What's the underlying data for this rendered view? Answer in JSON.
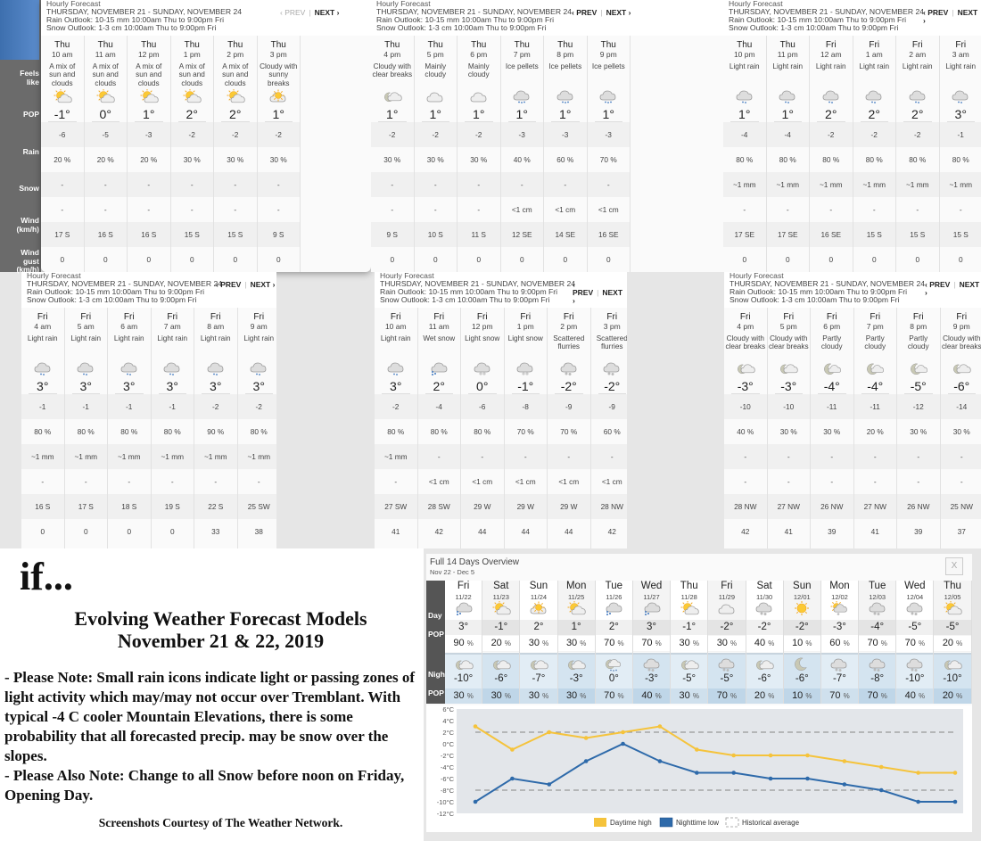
{
  "hourly_header": {
    "title": "Hourly Forecast",
    "range": "THURSDAY, NOVEMBER 21 - SUNDAY, NOVEMBER 24",
    "rain_outlook": "Rain Outlook: 10-15 mm 10:00am Thu to 9:00pm Fri",
    "snow_outlook": "Snow Outlook: 1-3 cm 10:00am Thu to 9:00pm Fri",
    "prev_label": "‹ PREV",
    "separator": "|",
    "next_label": "NEXT ›"
  },
  "row_labels": {
    "feels_like": "Feels\nlike",
    "pop": "POP",
    "rain": "Rain",
    "snow": "Snow",
    "wind": "Wind\n(km/h)",
    "gust": "Wind\ngust\n(km/h)"
  },
  "panels": [
    {
      "prev_disabled": true,
      "hours": [
        {
          "day": "Thu",
          "hour": "10 am",
          "cond": "A mix of\nsun and\nclouds",
          "icon": "sun-cloud-icon",
          "temp": "-1°",
          "feels": "-6",
          "pop": "20 %",
          "rain": "-",
          "snow": "-",
          "wind": "17 S",
          "gust": "0"
        },
        {
          "day": "Thu",
          "hour": "11 am",
          "cond": "A mix of\nsun and\nclouds",
          "icon": "sun-cloud-icon",
          "temp": "0°",
          "feels": "-5",
          "pop": "20 %",
          "rain": "-",
          "snow": "-",
          "wind": "16 S",
          "gust": "0"
        },
        {
          "day": "Thu",
          "hour": "12 pm",
          "cond": "A mix of\nsun and\nclouds",
          "icon": "sun-cloud-icon",
          "temp": "1°",
          "feels": "-3",
          "pop": "20 %",
          "rain": "-",
          "snow": "-",
          "wind": "16 S",
          "gust": "0"
        },
        {
          "day": "Thu",
          "hour": "1 pm",
          "cond": "A mix of\nsun and\nclouds",
          "icon": "sun-cloud-icon",
          "temp": "2°",
          "feels": "-2",
          "pop": "30 %",
          "rain": "-",
          "snow": "-",
          "wind": "15 S",
          "gust": "0"
        },
        {
          "day": "Thu",
          "hour": "2 pm",
          "cond": "A mix of\nsun and\nclouds",
          "icon": "sun-cloud-icon",
          "temp": "2°",
          "feels": "-2",
          "pop": "30 %",
          "rain": "-",
          "snow": "-",
          "wind": "15 S",
          "gust": "0"
        },
        {
          "day": "Thu",
          "hour": "3 pm",
          "cond": "Cloudy with\nsunny\nbreaks",
          "icon": "cloud-sun-icon",
          "temp": "1°",
          "feels": "-2",
          "pop": "30 %",
          "rain": "-",
          "snow": "-",
          "wind": "9 S",
          "gust": "0"
        }
      ]
    },
    {
      "prev_disabled": false,
      "hours": [
        {
          "day": "Thu",
          "hour": "4 pm",
          "cond": "Cloudy with\nclear breaks",
          "icon": "cloud-moon-icon",
          "temp": "1°",
          "feels": "-2",
          "pop": "30 %",
          "rain": "-",
          "snow": "-",
          "wind": "9 S",
          "gust": "0"
        },
        {
          "day": "Thu",
          "hour": "5 pm",
          "cond": "Mainly\ncloudy",
          "icon": "cloud-icon",
          "temp": "1°",
          "feels": "-2",
          "pop": "30 %",
          "rain": "-",
          "snow": "-",
          "wind": "10 S",
          "gust": "0"
        },
        {
          "day": "Thu",
          "hour": "6 pm",
          "cond": "Mainly\ncloudy",
          "icon": "cloud-icon",
          "temp": "1°",
          "feels": "-2",
          "pop": "30 %",
          "rain": "-",
          "snow": "-",
          "wind": "11 S",
          "gust": "0"
        },
        {
          "day": "Thu",
          "hour": "7 pm",
          "cond": "Ice pellets",
          "icon": "ice-pellets-icon",
          "temp": "1°",
          "feels": "-3",
          "pop": "40 %",
          "rain": "-",
          "snow": "<1  cm",
          "wind": "12 SE",
          "gust": "0"
        },
        {
          "day": "Thu",
          "hour": "8 pm",
          "cond": "Ice pellets",
          "icon": "ice-pellets-icon",
          "temp": "1°",
          "feels": "-3",
          "pop": "60 %",
          "rain": "-",
          "snow": "<1  cm",
          "wind": "14 SE",
          "gust": "0"
        },
        {
          "day": "Thu",
          "hour": "9 pm",
          "cond": "Ice pellets",
          "icon": "ice-pellets-icon",
          "temp": "1°",
          "feels": "-3",
          "pop": "70 %",
          "rain": "-",
          "snow": "<1  cm",
          "wind": "16 SE",
          "gust": "0"
        }
      ]
    },
    {
      "prev_disabled": false,
      "hours": [
        {
          "day": "Thu",
          "hour": "10 pm",
          "cond": "Light rain",
          "icon": "light-rain-icon",
          "temp": "1°",
          "feels": "-4",
          "pop": "80 %",
          "rain": "~1  mm",
          "snow": "-",
          "wind": "17 SE",
          "gust": "0"
        },
        {
          "day": "Thu",
          "hour": "11 pm",
          "cond": "Light rain",
          "icon": "light-rain-icon",
          "temp": "1°",
          "feels": "-4",
          "pop": "80 %",
          "rain": "~1  mm",
          "snow": "-",
          "wind": "17 SE",
          "gust": "0"
        },
        {
          "day": "Fri",
          "hour": "12 am",
          "cond": "Light rain",
          "icon": "light-rain-icon",
          "temp": "2°",
          "feels": "-2",
          "pop": "80 %",
          "rain": "~1  mm",
          "snow": "-",
          "wind": "16 SE",
          "gust": "0"
        },
        {
          "day": "Fri",
          "hour": "1 am",
          "cond": "Light rain",
          "icon": "light-rain-icon",
          "temp": "2°",
          "feels": "-2",
          "pop": "80 %",
          "rain": "~1  mm",
          "snow": "-",
          "wind": "15 S",
          "gust": "0"
        },
        {
          "day": "Fri",
          "hour": "2 am",
          "cond": "Light rain",
          "icon": "light-rain-icon",
          "temp": "2°",
          "feels": "-2",
          "pop": "80 %",
          "rain": "~1  mm",
          "snow": "-",
          "wind": "15 S",
          "gust": "0"
        },
        {
          "day": "Fri",
          "hour": "3 am",
          "cond": "Light rain",
          "icon": "light-rain-icon",
          "temp": "3°",
          "feels": "-1",
          "pop": "80 %",
          "rain": "~1  mm",
          "snow": "-",
          "wind": "15 S",
          "gust": "0"
        }
      ]
    },
    {
      "prev_disabled": false,
      "hours": [
        {
          "day": "Fri",
          "hour": "4 am",
          "cond": "Light rain",
          "icon": "light-rain-icon",
          "temp": "3°",
          "feels": "-1",
          "pop": "80 %",
          "rain": "~1  mm",
          "snow": "-",
          "wind": "16 S",
          "gust": "0"
        },
        {
          "day": "Fri",
          "hour": "5 am",
          "cond": "Light rain",
          "icon": "light-rain-icon",
          "temp": "3°",
          "feels": "-1",
          "pop": "80 %",
          "rain": "~1  mm",
          "snow": "-",
          "wind": "17 S",
          "gust": "0"
        },
        {
          "day": "Fri",
          "hour": "6 am",
          "cond": "Light rain",
          "icon": "light-rain-icon",
          "temp": "3°",
          "feels": "-1",
          "pop": "80 %",
          "rain": "~1  mm",
          "snow": "-",
          "wind": "18 S",
          "gust": "0"
        },
        {
          "day": "Fri",
          "hour": "7 am",
          "cond": "Light rain",
          "icon": "light-rain-icon",
          "temp": "3°",
          "feels": "-1",
          "pop": "80 %",
          "rain": "~1  mm",
          "snow": "-",
          "wind": "19 S",
          "gust": "0"
        },
        {
          "day": "Fri",
          "hour": "8 am",
          "cond": "Light rain",
          "icon": "light-rain-icon",
          "temp": "3°",
          "feels": "-2",
          "pop": "90 %",
          "rain": "~1  mm",
          "snow": "-",
          "wind": "22 S",
          "gust": "33"
        },
        {
          "day": "Fri",
          "hour": "9 am",
          "cond": "Light rain",
          "icon": "light-rain-icon",
          "temp": "3°",
          "feels": "-2",
          "pop": "80 %",
          "rain": "~1  mm",
          "snow": "-",
          "wind": "25 SW",
          "gust": "38"
        }
      ]
    },
    {
      "prev_disabled": false,
      "hours": [
        {
          "day": "Fri",
          "hour": "10 am",
          "cond": "Light rain",
          "icon": "light-rain-icon",
          "temp": "3°",
          "feels": "-2",
          "pop": "80 %",
          "rain": "~1  mm",
          "snow": "-",
          "wind": "27 SW",
          "gust": "41"
        },
        {
          "day": "Fri",
          "hour": "11 am",
          "cond": "Wet snow",
          "icon": "wet-snow-icon",
          "temp": "2°",
          "feels": "-4",
          "pop": "80 %",
          "rain": "-",
          "snow": "<1  cm",
          "wind": "28 SW",
          "gust": "42"
        },
        {
          "day": "Fri",
          "hour": "12 pm",
          "cond": "Light snow",
          "icon": "light-snow-icon",
          "temp": "0°",
          "feels": "-6",
          "pop": "80 %",
          "rain": "-",
          "snow": "<1  cm",
          "wind": "29 W",
          "gust": "44"
        },
        {
          "day": "Fri",
          "hour": "1 pm",
          "cond": "Light snow",
          "icon": "light-snow-icon",
          "temp": "-1°",
          "feels": "-8",
          "pop": "70 %",
          "rain": "-",
          "snow": "<1  cm",
          "wind": "29 W",
          "gust": "44"
        },
        {
          "day": "Fri",
          "hour": "2 pm",
          "cond": "Scattered\nflurries",
          "icon": "flurries-icon",
          "temp": "-2°",
          "feels": "-9",
          "pop": "70 %",
          "rain": "-",
          "snow": "<1  cm",
          "wind": "29 W",
          "gust": "44"
        },
        {
          "day": "Fri",
          "hour": "3 pm",
          "cond": "Scattered\nflurries",
          "icon": "flurries-icon",
          "temp": "-2°",
          "feels": "-9",
          "pop": "60 %",
          "rain": "-",
          "snow": "<1  cm",
          "wind": "28 NW",
          "gust": "42"
        }
      ]
    },
    {
      "prev_disabled": false,
      "hours": [
        {
          "day": "Fri",
          "hour": "4 pm",
          "cond": "Cloudy with\nclear breaks",
          "icon": "cloud-moon-icon",
          "temp": "-3°",
          "feels": "-10",
          "pop": "40 %",
          "rain": "-",
          "snow": "-",
          "wind": "28 NW",
          "gust": "42"
        },
        {
          "day": "Fri",
          "hour": "5 pm",
          "cond": "Cloudy with\nclear breaks",
          "icon": "cloud-moon-icon",
          "temp": "-3°",
          "feels": "-10",
          "pop": "30 %",
          "rain": "-",
          "snow": "-",
          "wind": "27 NW",
          "gust": "41"
        },
        {
          "day": "Fri",
          "hour": "6 pm",
          "cond": "Partly\ncloudy",
          "icon": "moon-cloud-icon",
          "temp": "-4°",
          "feels": "-11",
          "pop": "30 %",
          "rain": "-",
          "snow": "-",
          "wind": "26 NW",
          "gust": "39"
        },
        {
          "day": "Fri",
          "hour": "7 pm",
          "cond": "Partly\ncloudy",
          "icon": "moon-cloud-icon",
          "temp": "-4°",
          "feels": "-11",
          "pop": "20 %",
          "rain": "-",
          "snow": "-",
          "wind": "27 NW",
          "gust": "41"
        },
        {
          "day": "Fri",
          "hour": "8 pm",
          "cond": "Partly\ncloudy",
          "icon": "moon-cloud-icon",
          "temp": "-5°",
          "feels": "-12",
          "pop": "30 %",
          "rain": "-",
          "snow": "-",
          "wind": "26 NW",
          "gust": "39"
        },
        {
          "day": "Fri",
          "hour": "9 pm",
          "cond": "Cloudy with\nclear breaks",
          "icon": "cloud-moon-icon",
          "temp": "-6°",
          "feels": "-14",
          "pop": "30 %",
          "rain": "-",
          "snow": "-",
          "wind": "25 NW",
          "gust": "37"
        }
      ]
    }
  ],
  "note": {
    "if": "if...",
    "title_line1": "Evolving Weather Forecast Models",
    "title_line2": "November 21 & 22, 2019",
    "body": "- Please Note: Small rain icons indicate light or passing zones of light activity which may/may not occur over Tremblant. With typical -4 C cooler Mountain Elevations, there is some probability that all forecasted precip. may be snow over the slopes.\n- Please Also Note: Change to all Snow before noon on Friday, Opening Day.",
    "credit": "Screenshots Courtesy of The Weather Network."
  },
  "overview": {
    "title": "Full 14 Days Overview",
    "subtitle": "Nov 22 - Dec 5",
    "close_label": "X",
    "day_label": "Day",
    "pop_label": "POP",
    "night_label": "Night",
    "pct": "%",
    "days": [
      {
        "name": "Fri",
        "date": "11/22",
        "day_icon": "wet-snow-icon",
        "day_temp": "3°",
        "day_pop": "90",
        "night_icon": "cloud-moon-icon",
        "night_temp": "-10°",
        "night_pop": "30"
      },
      {
        "name": "Sat",
        "date": "11/23",
        "day_icon": "sun-cloud-icon",
        "day_temp": "-1°",
        "day_pop": "20",
        "night_icon": "cloud-moon-icon",
        "night_temp": "-6°",
        "night_pop": "30"
      },
      {
        "name": "Sun",
        "date": "11/24",
        "day_icon": "cloud-sun-icon",
        "day_temp": "2°",
        "day_pop": "30",
        "night_icon": "cloud-moon-icon",
        "night_temp": "-7°",
        "night_pop": "30"
      },
      {
        "name": "Mon",
        "date": "11/25",
        "day_icon": "sun-cloud-icon",
        "day_temp": "1°",
        "day_pop": "30",
        "night_icon": "cloud-moon-icon",
        "night_temp": "-3°",
        "night_pop": "30"
      },
      {
        "name": "Tue",
        "date": "11/26",
        "day_icon": "wet-snow-icon",
        "day_temp": "2°",
        "day_pop": "70",
        "night_icon": "moon-rain-icon",
        "night_temp": "0°",
        "night_pop": "70"
      },
      {
        "name": "Wed",
        "date": "11/27",
        "day_icon": "wet-snow-icon",
        "day_temp": "3°",
        "day_pop": "70",
        "night_icon": "flurries-icon",
        "night_temp": "-3°",
        "night_pop": "40"
      },
      {
        "name": "Thu",
        "date": "11/28",
        "day_icon": "sun-cloud-icon",
        "day_temp": "-1°",
        "day_pop": "30",
        "night_icon": "cloud-moon-icon",
        "night_temp": "-5°",
        "night_pop": "30"
      },
      {
        "name": "Fri",
        "date": "11/29",
        "day_icon": "cloud-icon",
        "day_temp": "-2°",
        "day_pop": "30",
        "night_icon": "flurries-icon",
        "night_temp": "-5°",
        "night_pop": "70"
      },
      {
        "name": "Sat",
        "date": "11/30",
        "day_icon": "flurries-icon",
        "day_temp": "-2°",
        "day_pop": "40",
        "night_icon": "cloud-moon-icon",
        "night_temp": "-6°",
        "night_pop": "20"
      },
      {
        "name": "Sun",
        "date": "12/01",
        "day_icon": "sun-icon",
        "day_temp": "-2°",
        "day_pop": "10",
        "night_icon": "moon-icon",
        "night_temp": "-6°",
        "night_pop": "10"
      },
      {
        "name": "Mon",
        "date": "12/02",
        "day_icon": "sun-flurries-icon",
        "day_temp": "-3°",
        "day_pop": "60",
        "night_icon": "flurries-icon",
        "night_temp": "-7°",
        "night_pop": "70"
      },
      {
        "name": "Tue",
        "date": "12/03",
        "day_icon": "flurries-icon",
        "day_temp": "-4°",
        "day_pop": "70",
        "night_icon": "flurries-icon",
        "night_temp": "-8°",
        "night_pop": "70"
      },
      {
        "name": "Wed",
        "date": "12/04",
        "day_icon": "flurries-icon",
        "day_temp": "-5°",
        "day_pop": "70",
        "night_icon": "flurries-icon",
        "night_temp": "-10°",
        "night_pop": "40"
      },
      {
        "name": "Thu",
        "date": "12/05",
        "day_icon": "sun-cloud-icon",
        "day_temp": "-5°",
        "day_pop": "20",
        "night_icon": "cloud-moon-icon",
        "night_temp": "-10°",
        "night_pop": "20"
      }
    ]
  },
  "chart_data": {
    "type": "line",
    "x": [
      "11/22",
      "11/23",
      "11/24",
      "11/25",
      "11/26",
      "11/27",
      "11/28",
      "11/29",
      "11/30",
      "12/01",
      "12/02",
      "12/03",
      "12/04",
      "12/05"
    ],
    "series": [
      {
        "name": "Daytime high",
        "color": "#f5c33b",
        "values": [
          3,
          -1,
          2,
          1,
          2,
          3,
          -1,
          -2,
          -2,
          -2,
          -3,
          -4,
          -5,
          -5
        ]
      },
      {
        "name": "Nighttime low",
        "color": "#2e6aaa",
        "values": [
          -10,
          -6,
          -7,
          -3,
          0,
          -3,
          -5,
          -5,
          -6,
          -6,
          -7,
          -8,
          -10,
          -10
        ]
      },
      {
        "name": "Historical average",
        "color": "#999999",
        "dashed": true,
        "values_high": 2,
        "values_low": -8
      }
    ],
    "yticks": [
      "6°C",
      "4°C",
      "2°C",
      "0°C",
      "-2°C",
      "-4°C",
      "-6°C",
      "-8°C",
      "-10°C",
      "-12°C"
    ],
    "ylim": [
      -12,
      6
    ],
    "legend_position": "bottom-center",
    "grid": false
  }
}
